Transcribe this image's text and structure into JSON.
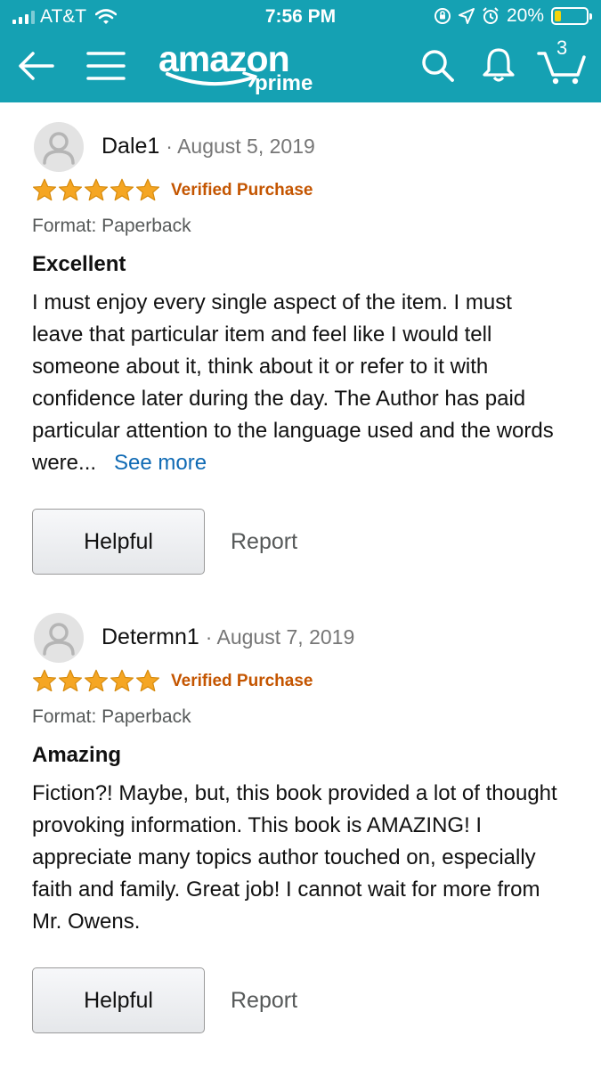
{
  "status_bar": {
    "carrier": "AT&T",
    "time": "7:56 PM",
    "battery": "20%",
    "battery_level": 0.2,
    "icons": [
      "signal-icon",
      "wifi-icon",
      "rotation-lock-icon",
      "location-icon",
      "alarm-icon",
      "battery-icon"
    ]
  },
  "header": {
    "logo_word": "amazon",
    "logo_sub": "prime",
    "cart_count": "3",
    "icons": [
      "back-arrow-icon",
      "menu-icon",
      "search-icon",
      "bell-icon",
      "cart-icon"
    ],
    "colors": {
      "background": "#15a1b3",
      "foreground": "#ffffff"
    }
  },
  "reviews": [
    {
      "author": "Dale1",
      "date": "August 5, 2019",
      "stars": 5,
      "verified": "Verified Purchase",
      "format": "Format: Paperback",
      "title": "Excellent",
      "body": "I must enjoy every single aspect of the item. I must leave that particular item and feel like I would tell someone about it, think about it or refer to it with confidence later during the day. The Author has paid particular attention to the language used and the words were...",
      "see_more": "See more",
      "helpful_label": "Helpful",
      "report_label": "Report"
    },
    {
      "author": "Determn1",
      "date": "August 7, 2019",
      "stars": 5,
      "verified": "Verified Purchase",
      "format": "Format: Paperback",
      "title": "Amazing",
      "body": "Fiction?! Maybe, but, this book provided a lot of thought provoking information. This book is AMAZING! I appreciate many topics author touched on, especially faith and family. Great job! I cannot wait for more from Mr. Owens.",
      "helpful_label": "Helpful",
      "report_label": "Report"
    }
  ],
  "colors": {
    "star": "#f5a623",
    "verified": "#c45500",
    "link": "#0f6ab4"
  }
}
